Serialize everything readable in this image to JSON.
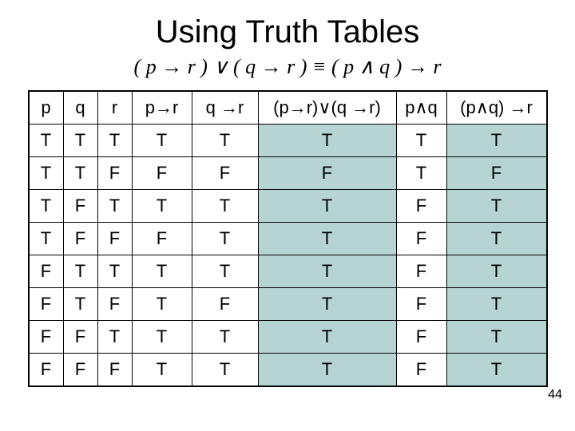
{
  "title": "Using Truth Tables",
  "equation": "( p → r ) ∨ ( q → r ) ≡ ( p ∧ q ) → r",
  "page_number": "44",
  "headers": {
    "p": "p",
    "q": "q",
    "r": "r",
    "p_imp_r": "p→r",
    "q_imp_r": "q →r",
    "disj": "(p→r)∨(q →r)",
    "p_and_q": "p∧q",
    "result": "(p∧q) →r"
  },
  "rows": [
    {
      "p": "T",
      "q": "T",
      "r": "T",
      "p_imp_r": "T",
      "q_imp_r": "T",
      "disj": "T",
      "p_and_q": "T",
      "result": "T"
    },
    {
      "p": "T",
      "q": "T",
      "r": "F",
      "p_imp_r": "F",
      "q_imp_r": "F",
      "disj": "F",
      "p_and_q": "T",
      "result": "F"
    },
    {
      "p": "T",
      "q": "F",
      "r": "T",
      "p_imp_r": "T",
      "q_imp_r": "T",
      "disj": "T",
      "p_and_q": "F",
      "result": "T"
    },
    {
      "p": "T",
      "q": "F",
      "r": "F",
      "p_imp_r": "F",
      "q_imp_r": "T",
      "disj": "T",
      "p_and_q": "F",
      "result": "T"
    },
    {
      "p": "F",
      "q": "T",
      "r": "T",
      "p_imp_r": "T",
      "q_imp_r": "T",
      "disj": "T",
      "p_and_q": "F",
      "result": "T"
    },
    {
      "p": "F",
      "q": "T",
      "r": "F",
      "p_imp_r": "T",
      "q_imp_r": "F",
      "disj": "T",
      "p_and_q": "F",
      "result": "T"
    },
    {
      "p": "F",
      "q": "F",
      "r": "T",
      "p_imp_r": "T",
      "q_imp_r": "T",
      "disj": "T",
      "p_and_q": "F",
      "result": "T"
    },
    {
      "p": "F",
      "q": "F",
      "r": "F",
      "p_imp_r": "T",
      "q_imp_r": "T",
      "disj": "T",
      "p_and_q": "F",
      "result": "T"
    }
  ]
}
